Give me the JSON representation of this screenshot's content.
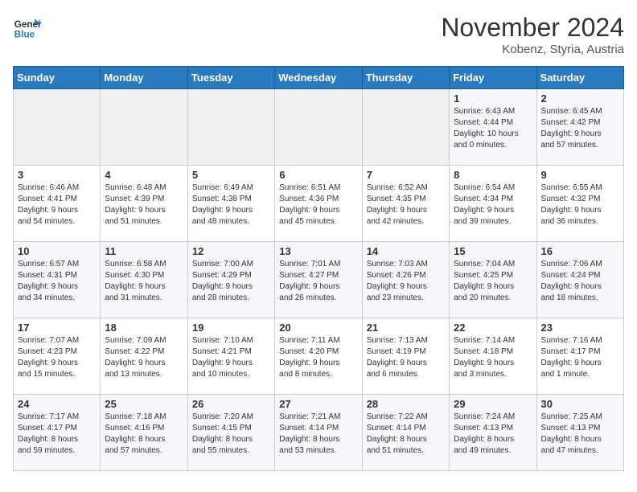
{
  "header": {
    "logo_line1": "General",
    "logo_line2": "Blue",
    "month": "November 2024",
    "location": "Kobenz, Styria, Austria"
  },
  "weekdays": [
    "Sunday",
    "Monday",
    "Tuesday",
    "Wednesday",
    "Thursday",
    "Friday",
    "Saturday"
  ],
  "weeks": [
    [
      {
        "day": "",
        "info": ""
      },
      {
        "day": "",
        "info": ""
      },
      {
        "day": "",
        "info": ""
      },
      {
        "day": "",
        "info": ""
      },
      {
        "day": "",
        "info": ""
      },
      {
        "day": "1",
        "info": "Sunrise: 6:43 AM\nSunset: 4:44 PM\nDaylight: 10 hours\nand 0 minutes."
      },
      {
        "day": "2",
        "info": "Sunrise: 6:45 AM\nSunset: 4:42 PM\nDaylight: 9 hours\nand 57 minutes."
      }
    ],
    [
      {
        "day": "3",
        "info": "Sunrise: 6:46 AM\nSunset: 4:41 PM\nDaylight: 9 hours\nand 54 minutes."
      },
      {
        "day": "4",
        "info": "Sunrise: 6:48 AM\nSunset: 4:39 PM\nDaylight: 9 hours\nand 51 minutes."
      },
      {
        "day": "5",
        "info": "Sunrise: 6:49 AM\nSunset: 4:38 PM\nDaylight: 9 hours\nand 48 minutes."
      },
      {
        "day": "6",
        "info": "Sunrise: 6:51 AM\nSunset: 4:36 PM\nDaylight: 9 hours\nand 45 minutes."
      },
      {
        "day": "7",
        "info": "Sunrise: 6:52 AM\nSunset: 4:35 PM\nDaylight: 9 hours\nand 42 minutes."
      },
      {
        "day": "8",
        "info": "Sunrise: 6:54 AM\nSunset: 4:34 PM\nDaylight: 9 hours\nand 39 minutes."
      },
      {
        "day": "9",
        "info": "Sunrise: 6:55 AM\nSunset: 4:32 PM\nDaylight: 9 hours\nand 36 minutes."
      }
    ],
    [
      {
        "day": "10",
        "info": "Sunrise: 6:57 AM\nSunset: 4:31 PM\nDaylight: 9 hours\nand 34 minutes."
      },
      {
        "day": "11",
        "info": "Sunrise: 6:58 AM\nSunset: 4:30 PM\nDaylight: 9 hours\nand 31 minutes."
      },
      {
        "day": "12",
        "info": "Sunrise: 7:00 AM\nSunset: 4:29 PM\nDaylight: 9 hours\nand 28 minutes."
      },
      {
        "day": "13",
        "info": "Sunrise: 7:01 AM\nSunset: 4:27 PM\nDaylight: 9 hours\nand 26 minutes."
      },
      {
        "day": "14",
        "info": "Sunrise: 7:03 AM\nSunset: 4:26 PM\nDaylight: 9 hours\nand 23 minutes."
      },
      {
        "day": "15",
        "info": "Sunrise: 7:04 AM\nSunset: 4:25 PM\nDaylight: 9 hours\nand 20 minutes."
      },
      {
        "day": "16",
        "info": "Sunrise: 7:06 AM\nSunset: 4:24 PM\nDaylight: 9 hours\nand 18 minutes."
      }
    ],
    [
      {
        "day": "17",
        "info": "Sunrise: 7:07 AM\nSunset: 4:23 PM\nDaylight: 9 hours\nand 15 minutes."
      },
      {
        "day": "18",
        "info": "Sunrise: 7:09 AM\nSunset: 4:22 PM\nDaylight: 9 hours\nand 13 minutes."
      },
      {
        "day": "19",
        "info": "Sunrise: 7:10 AM\nSunset: 4:21 PM\nDaylight: 9 hours\nand 10 minutes."
      },
      {
        "day": "20",
        "info": "Sunrise: 7:11 AM\nSunset: 4:20 PM\nDaylight: 9 hours\nand 8 minutes."
      },
      {
        "day": "21",
        "info": "Sunrise: 7:13 AM\nSunset: 4:19 PM\nDaylight: 9 hours\nand 6 minutes."
      },
      {
        "day": "22",
        "info": "Sunrise: 7:14 AM\nSunset: 4:18 PM\nDaylight: 9 hours\nand 3 minutes."
      },
      {
        "day": "23",
        "info": "Sunrise: 7:16 AM\nSunset: 4:17 PM\nDaylight: 9 hours\nand 1 minute."
      }
    ],
    [
      {
        "day": "24",
        "info": "Sunrise: 7:17 AM\nSunset: 4:17 PM\nDaylight: 8 hours\nand 59 minutes."
      },
      {
        "day": "25",
        "info": "Sunrise: 7:18 AM\nSunset: 4:16 PM\nDaylight: 8 hours\nand 57 minutes."
      },
      {
        "day": "26",
        "info": "Sunrise: 7:20 AM\nSunset: 4:15 PM\nDaylight: 8 hours\nand 55 minutes."
      },
      {
        "day": "27",
        "info": "Sunrise: 7:21 AM\nSunset: 4:14 PM\nDaylight: 8 hours\nand 53 minutes."
      },
      {
        "day": "28",
        "info": "Sunrise: 7:22 AM\nSunset: 4:14 PM\nDaylight: 8 hours\nand 51 minutes."
      },
      {
        "day": "29",
        "info": "Sunrise: 7:24 AM\nSunset: 4:13 PM\nDaylight: 8 hours\nand 49 minutes."
      },
      {
        "day": "30",
        "info": "Sunrise: 7:25 AM\nSunset: 4:13 PM\nDaylight: 8 hours\nand 47 minutes."
      }
    ]
  ]
}
